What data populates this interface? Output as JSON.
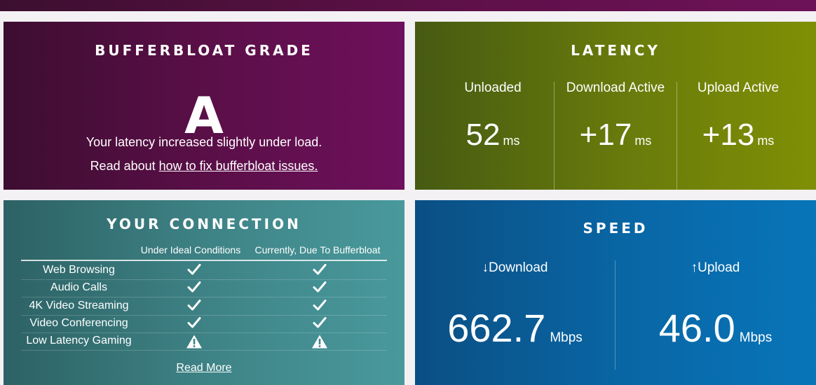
{
  "grade": {
    "title": "BUFFERBLOAT GRADE",
    "letter": "A",
    "message": "Your latency increased slightly under load.",
    "read_prefix": "Read about ",
    "fix_link": "how to fix bufferbloat issues."
  },
  "latency": {
    "title": "LATENCY",
    "columns": [
      {
        "label": "Unloaded",
        "value": "52",
        "unit": "ms"
      },
      {
        "label": "Download Active",
        "value": "+17",
        "unit": "ms"
      },
      {
        "label": "Upload Active",
        "value": "+13",
        "unit": "ms"
      }
    ]
  },
  "connection": {
    "title": "YOUR CONNECTION",
    "headers": [
      "Under Ideal Conditions",
      "Currently, Due To Bufferbloat"
    ],
    "rows": [
      {
        "name": "Web Browsing",
        "ideal": "check-icon",
        "current": "check-icon"
      },
      {
        "name": "Audio Calls",
        "ideal": "check-icon",
        "current": "check-icon"
      },
      {
        "name": "4K Video Streaming",
        "ideal": "check-icon",
        "current": "check-icon"
      },
      {
        "name": "Video Conferencing",
        "ideal": "check-icon",
        "current": "check-icon"
      },
      {
        "name": "Low Latency Gaming",
        "ideal": "warning-icon",
        "current": "warning-icon"
      }
    ],
    "read_more": "Read More"
  },
  "speed": {
    "title": "SPEED",
    "download": {
      "arrow": "↓",
      "label": "Download",
      "value": "662.7",
      "unit": "Mbps"
    },
    "upload": {
      "arrow": "↑",
      "label": "Upload",
      "value": "46.0",
      "unit": "Mbps"
    }
  },
  "colors": {
    "grade_bg": "#5a0f47",
    "latency_bg": "#6a7c0b",
    "connection_bg": "#3f8588",
    "speed_bg": "#0967a6"
  }
}
